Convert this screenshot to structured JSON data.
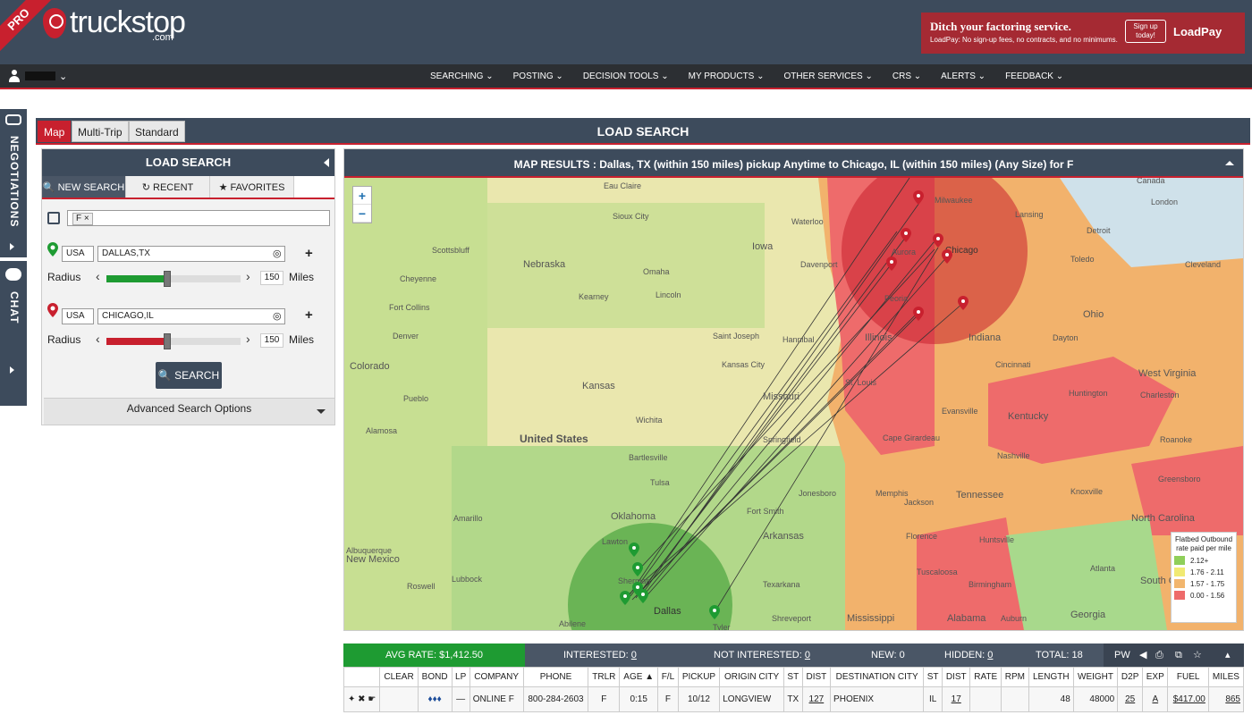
{
  "header": {
    "ribbon": "PRO",
    "logo_text": "truckstop",
    "logo_sub": ".com",
    "ad": {
      "headline": "Ditch your factoring service.",
      "sub": "LoadPay: No sign-up fees, no contracts, and no minimums.",
      "button": "Sign up today!",
      "brand": "LoadPay"
    }
  },
  "nav": {
    "items": [
      "SEARCHING",
      "POSTING",
      "DECISION TOOLS",
      "MY PRODUCTS",
      "OTHER SERVICES",
      "CRS",
      "ALERTS",
      "FEEDBACK"
    ]
  },
  "side": {
    "negotiations": "NEGOTIATIONS",
    "chat": "CHAT"
  },
  "tabs": {
    "map": "Map",
    "multitrip": "Multi-Trip",
    "standard": "Standard",
    "title": "LOAD SEARCH"
  },
  "search": {
    "title": "LOAD SEARCH",
    "tab_new": "NEW SEARCH",
    "tab_recent": "RECENT",
    "tab_fav": "FAVORITES",
    "equip_chip": "F",
    "origin": {
      "country": "USA",
      "city": "DALLAS,TX",
      "radius_label": "Radius",
      "radius": "150",
      "unit": "Miles",
      "radius_fraction": 0.45
    },
    "dest": {
      "country": "USA",
      "city": "CHICAGO,IL",
      "radius_label": "Radius",
      "radius": "150",
      "unit": "Miles",
      "radius_fraction": 0.45
    },
    "search_btn": "SEARCH",
    "advanced": "Advanced Search Options"
  },
  "map": {
    "title_prefix": "MAP RESULTS :",
    "title": "Dallas, TX (within 150 miles) pickup Anytime to Chicago, IL (within 150 miles) (Any Size) for F",
    "zoom_in": "+",
    "zoom_out": "−",
    "legend": {
      "title": "Flatbed Outbound rate paid per mile",
      "items": [
        {
          "label": "2.12+",
          "color": "#8fcf5a"
        },
        {
          "label": "1.76 - 2.11",
          "color": "#f1ea73"
        },
        {
          "label": "1.57 - 1.75",
          "color": "#f2b66e"
        },
        {
          "label": "0.00 - 1.56",
          "color": "#ee6b6b"
        }
      ]
    },
    "labels": [
      "Milwaukee",
      "Chicago",
      "Sioux City",
      "Waterloo",
      "Iowa",
      "Nebraska",
      "Omaha",
      "Lincoln",
      "Kearney",
      "Cheyenne",
      "Fort Collins",
      "Denver",
      "Colorado",
      "Pueblo",
      "Alamosa",
      "Kansas",
      "Wichita",
      "United States",
      "Saint Joseph",
      "Kansas City",
      "Missouri",
      "Springfield",
      "Oklahoma",
      "Tulsa",
      "Bartlesville",
      "Amarillo",
      "Lubbock",
      "Roswell",
      "Abilene",
      "Dallas",
      "Tyler",
      "Texarkana",
      "Shreveport",
      "Arkansas",
      "Fort Smith",
      "Jonesboro",
      "Memphis",
      "Mississippi",
      "Jackson",
      "Alabama",
      "Georgia",
      "Tennessee",
      "Kentucky",
      "Evansville",
      "Illinois",
      "Peoria",
      "Indiana",
      "Ohio",
      "Dayton",
      "Cincinnati",
      "Detroit",
      "Toledo",
      "Cleveland",
      "Lansing",
      "West Virginia",
      "Huntington",
      "Charleston",
      "Roanoke",
      "Knoxville",
      "Nashville",
      "Huntsville",
      "Birmingham",
      "Florence",
      "Tuscaloosa",
      "Auburn",
      "Atlanta",
      "North Carolina",
      "Greensboro",
      "South Ca",
      "New Mexico",
      "Albuquerque",
      "Davenport",
      "Scottsbluff",
      "Hannibal",
      "St. Louis",
      "Cape Girardeau",
      "Lawton",
      "Sherman",
      "Canada",
      "London",
      "Eau Claire",
      "Aurora"
    ]
  },
  "stats": {
    "avg": "AVG RATE: $1,412.50",
    "interested_label": "INTERESTED:",
    "interested": "0",
    "not_label": "NOT INTERESTED:",
    "not": "0",
    "new": "NEW: 0",
    "hidden_label": "HIDDEN:",
    "hidden": "0",
    "total": "TOTAL: 18",
    "pw": "PW"
  },
  "table": {
    "headers": [
      "",
      "CLEAR",
      "BOND",
      "LP",
      "COMPANY",
      "PHONE",
      "TRLR",
      "AGE ▲",
      "F/L",
      "PICKUP",
      "ORIGIN CITY",
      "ST",
      "DIST",
      "DESTINATION CITY",
      "ST",
      "DIST",
      "RATE",
      "RPM",
      "LENGTH",
      "WEIGHT",
      "D2P",
      "EXP",
      "FUEL",
      "MILES"
    ],
    "rows": [
      [
        "",
        "",
        "♦♦♦",
        "—",
        "ONLINE F",
        "800-284-2603",
        "F",
        "0:15",
        "F",
        "10/12",
        "LONGVIEW",
        "TX",
        "127",
        "PHOENIX",
        "IL",
        "17",
        "",
        "",
        "48",
        "48000",
        "25",
        "A",
        "$417.00",
        "865"
      ]
    ]
  }
}
